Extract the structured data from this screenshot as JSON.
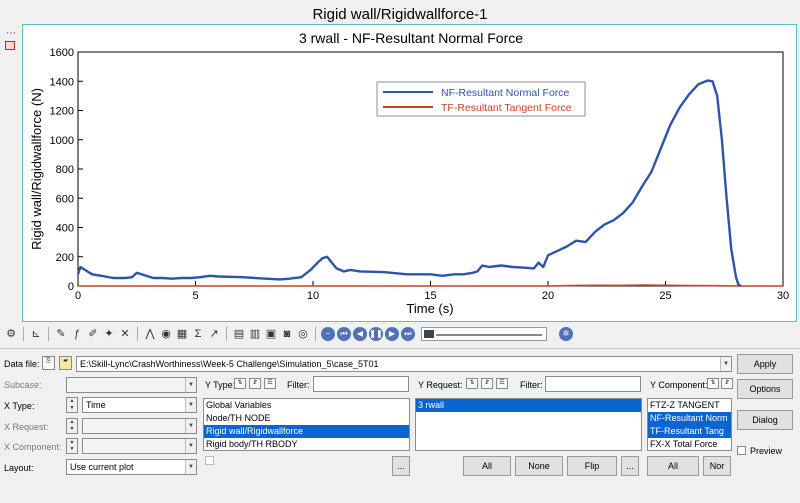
{
  "window": {
    "title": "Rigid wall/Rigidwallforce-1"
  },
  "colors": {
    "nf_series": "#2d54a8",
    "tf_series": "#c8402a",
    "selection": "#0a64d2",
    "plot_border": "#55c3c3"
  },
  "chart_data": {
    "type": "line",
    "title": "3 rwall - NF-Resultant Normal Force",
    "xlabel": "Time (s)",
    "ylabel": "Rigid wall/Rigidwallforce (N)",
    "xlim": [
      0,
      30
    ],
    "ylim": [
      0,
      1600
    ],
    "xticks": [
      "0",
      "5",
      "10",
      "15",
      "20",
      "25",
      "30"
    ],
    "yticks": [
      "0",
      "200",
      "400",
      "600",
      "800",
      "1000",
      "1200",
      "1400",
      "1600"
    ],
    "grid": false,
    "legend": "top-center",
    "series": [
      {
        "name": "NF-Resultant Normal Force",
        "color": "#2d54a8",
        "x": [
          0,
          0.1,
          0.3,
          0.6,
          1,
          1.5,
          2,
          2.3,
          2.5,
          2.8,
          3.2,
          3.6,
          4,
          4.4,
          4.8,
          5.2,
          5.6,
          6,
          7,
          8,
          8.6,
          9,
          9.5,
          9.9,
          10.2,
          10.4,
          10.6,
          10.8,
          11,
          11.3,
          11.6,
          12,
          13,
          14,
          15,
          15.5,
          16,
          16.4,
          16.8,
          17,
          17.2,
          17.5,
          18,
          18.5,
          19,
          19.4,
          19.6,
          19.8,
          20,
          20.4,
          20.8,
          21.2,
          21.6,
          22,
          22.4,
          22.8,
          23.2,
          23.6,
          24,
          24.4,
          24.8,
          25.2,
          25.6,
          26,
          26.4,
          26.8,
          27,
          27.2,
          27.4,
          27.6,
          27.8,
          28,
          28.1,
          28.2
        ],
        "y": [
          80,
          130,
          110,
          80,
          70,
          55,
          55,
          60,
          90,
          75,
          55,
          55,
          50,
          55,
          55,
          60,
          70,
          65,
          60,
          50,
          45,
          50,
          60,
          110,
          160,
          190,
          200,
          160,
          120,
          100,
          110,
          100,
          95,
          80,
          80,
          70,
          80,
          80,
          90,
          100,
          140,
          130,
          140,
          130,
          125,
          120,
          160,
          130,
          210,
          240,
          270,
          310,
          300,
          370,
          420,
          450,
          500,
          570,
          680,
          780,
          940,
          1100,
          1220,
          1310,
          1380,
          1405,
          1400,
          1300,
          1000,
          600,
          250,
          60,
          10,
          0
        ]
      },
      {
        "name": "TF-Resultant Tangent Force",
        "color": "#c8402a",
        "x": [
          0,
          5,
          10,
          15,
          20,
          21,
          22,
          23,
          24,
          25,
          26,
          27,
          28,
          30
        ],
        "y": [
          0,
          0,
          0,
          0,
          0,
          3,
          5,
          4,
          6,
          5,
          3,
          2,
          0,
          0
        ]
      }
    ]
  },
  "form": {
    "data_file_label": "Data file:",
    "data_file_value": "E:\\Skill-Lync\\CrashWorthiness\\Week-5 Challenge\\Simulation_5\\case_5T01",
    "apply": "Apply",
    "options": "Options",
    "dialog": "Dialog",
    "preview": "Preview",
    "subcase_label": "Subcase:",
    "x_type_label": "X Type:",
    "x_type_value": "Time",
    "x_request_label": "X Request:",
    "x_component_label": "X Component:",
    "layout_label": "Layout:",
    "layout_value": "Use current plot",
    "y_type_label": "Y Type:",
    "filter_label": "Filter:",
    "y_request_label": "Y Request:",
    "y_component_label": "Y Component:",
    "y_types": [
      "Global Variables",
      "Node/TH NODE",
      "Rigid wall/Rigidwallforce",
      "Rigid body/TH RBODY"
    ],
    "y_requests": [
      "3 rwall"
    ],
    "y_components": [
      "FTZ-Z TANGENT",
      "NF-Resultant Norm",
      "TF-Resultant Tang",
      "FX-X Total Force"
    ],
    "ellipsis": "...",
    "all": "All",
    "none": "None",
    "flip": "Flip",
    "all2": "All",
    "none_truncated": "Nor"
  }
}
